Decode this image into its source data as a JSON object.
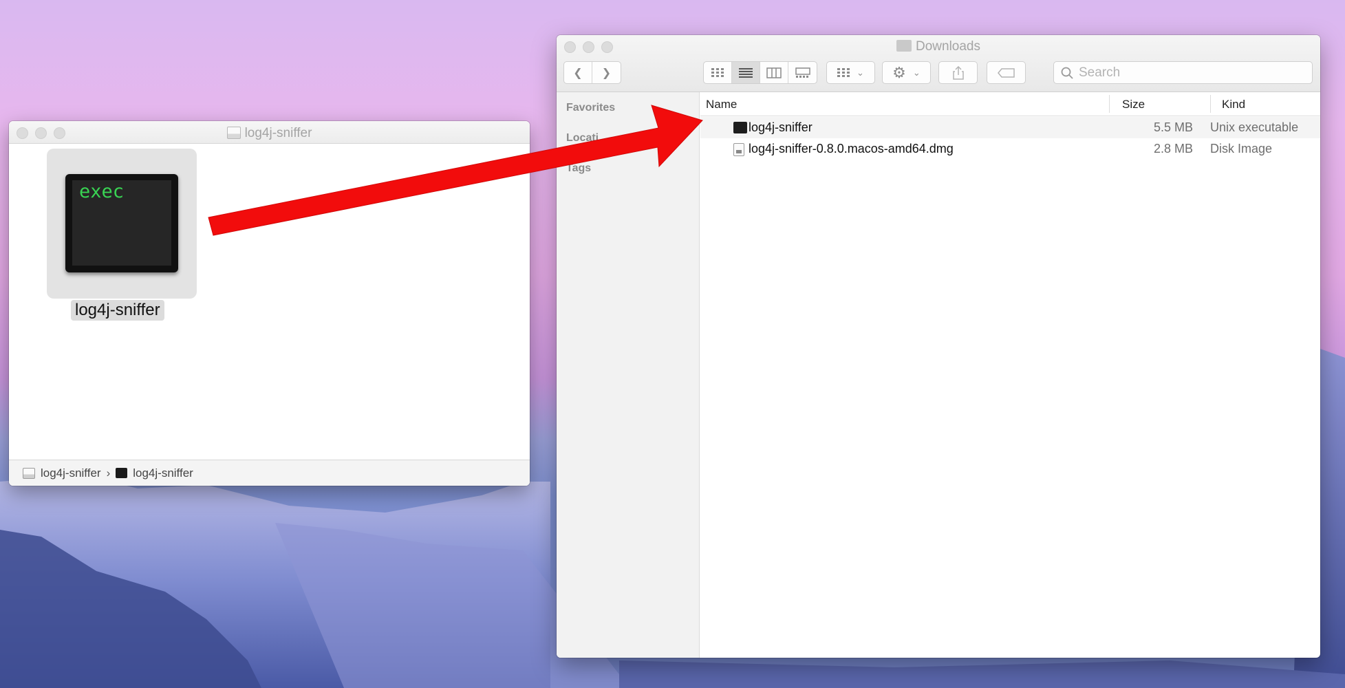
{
  "desktop": {
    "wallpaper": "Yosemite mountains"
  },
  "disk_window": {
    "title": "log4j-sniffer",
    "file": {
      "icon_text": "exec",
      "label": "log4j-sniffer"
    },
    "pathbar": {
      "volume": "log4j-sniffer",
      "file": "log4j-sniffer"
    }
  },
  "downloads_window": {
    "title": "Downloads",
    "search_placeholder": "Search",
    "sidebar": {
      "favorites": "Favorites",
      "locations": "Locati",
      "tags": "Tags"
    },
    "columns": {
      "name": "Name",
      "size": "Size",
      "kind": "Kind"
    },
    "files": [
      {
        "name": "log4j-sniffer",
        "size": "5.5 MB",
        "kind": "Unix executable",
        "icon": "terminal-icon"
      },
      {
        "name": "log4j-sniffer-0.8.0.macos-amd64.dmg",
        "size": "2.8 MB",
        "kind": "Disk Image",
        "icon": "disk-image-icon"
      }
    ]
  },
  "annotation": {
    "arrow_color": "#f20c0c"
  }
}
